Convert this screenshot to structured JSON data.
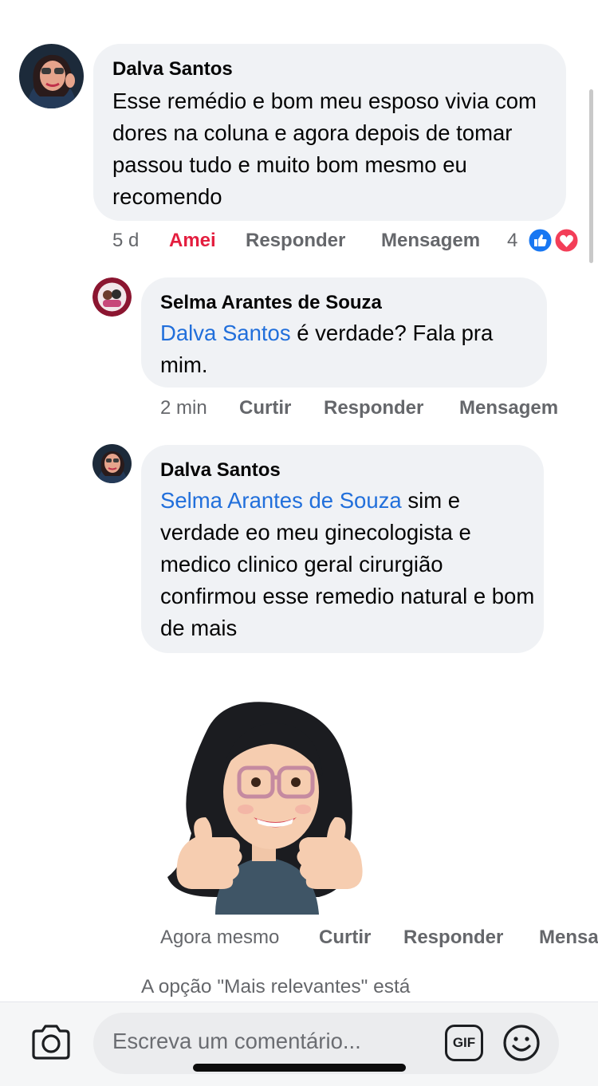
{
  "comments": [
    {
      "author": "Dalva Santos",
      "text": "Esse remédio e bom meu esposo vivia com dores na coluna e agora depois de tomar passou tudo e muito bom mesmo eu recomendo",
      "time": "5 d",
      "reaction_label": "Amei",
      "reply_label": "Responder",
      "message_label": "Mensagem",
      "reaction_count": "4",
      "reaction_icons": [
        "like-icon",
        "love-icon"
      ],
      "reaction_color": "#e41e3f"
    },
    {
      "author": "Selma Arantes de Souza",
      "mention": "Dalva Santos",
      "text": " é  verdade? Fala pra mim.",
      "time": "2 min",
      "like_label": "Curtir",
      "reply_label": "Responder",
      "message_label": "Mensagem"
    },
    {
      "author": "Dalva Santos",
      "mention": "Selma Arantes de Souza",
      "text": " sim e verdade eo meu ginecologista e medico clinico geral cirurgião confirmou esse remedio natural e bom de mais",
      "sticker": "memoji-thumbs-up-sticker",
      "time": "Agora mesmo",
      "like_label": "Curtir",
      "reply_label": "Responder",
      "message_label": "Mensa"
    }
  ],
  "footer_note": "A opção \"Mais relevantes\" está",
  "composer": {
    "placeholder": "Escreva um comentário...",
    "gif_label": "GIF",
    "icons": [
      "camera-icon",
      "gif-icon",
      "emoji-icon"
    ]
  },
  "colors": {
    "mention": "#216fdb",
    "bubble": "#f0f2f5",
    "meta": "#65676b",
    "like_blue": "#1877f2",
    "love_red": "#f33e58"
  }
}
